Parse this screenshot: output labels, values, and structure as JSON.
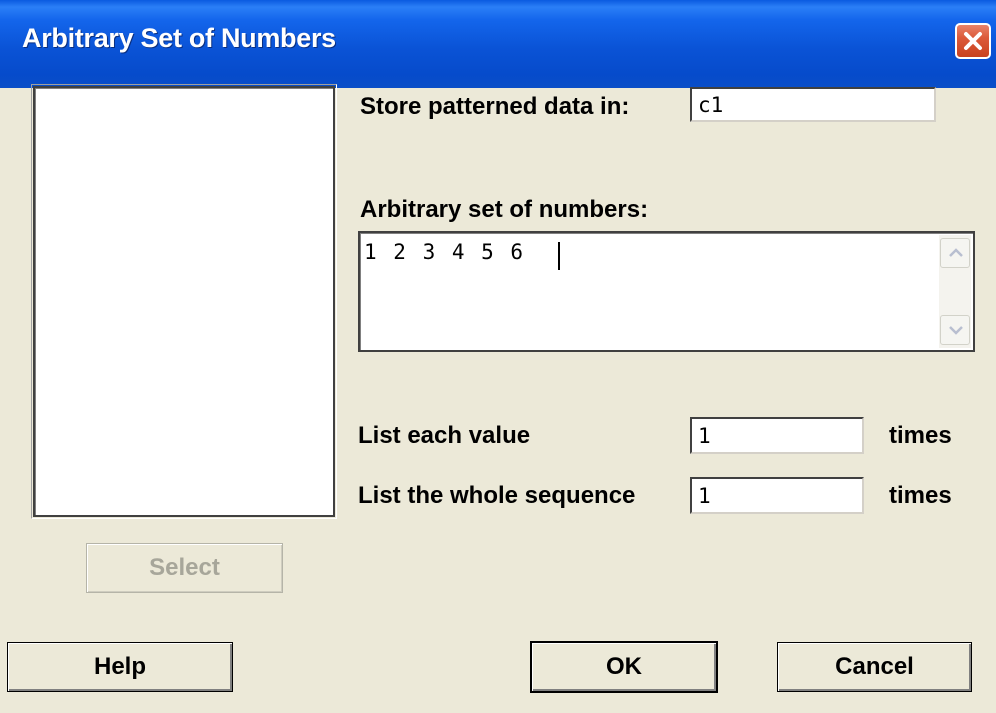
{
  "window": {
    "title": "Arbitrary Set of Numbers",
    "close_icon": "close-x-icon"
  },
  "form": {
    "store_label": "Store patterned data in:",
    "store_value": "c1",
    "numbers_label": "Arbitrary set of numbers:",
    "numbers_value": "1 2 3 4 5 6",
    "each_label": "List each value",
    "each_value": "1",
    "each_suffix": "times",
    "whole_label": "List the whole sequence",
    "whole_value": "1",
    "whole_suffix": "times"
  },
  "buttons": {
    "select": "Select",
    "help": "Help",
    "ok": "OK",
    "cancel": "Cancel"
  },
  "colors": {
    "titlebar": "#0a53d6",
    "dialog_bg": "#ece9d8",
    "close_button": "#dc5a3a"
  }
}
